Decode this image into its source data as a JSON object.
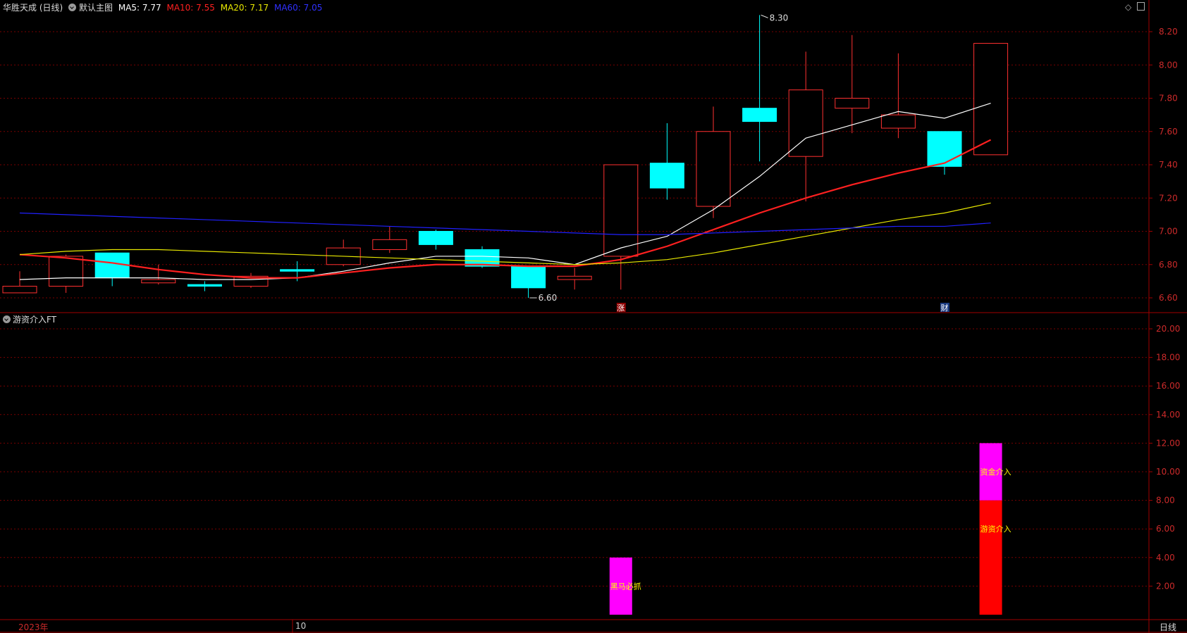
{
  "header": {
    "stock": "华胜天成 (日线)",
    "main_chart": "默认主图",
    "ma5_label": "MA5: 7.77",
    "ma10_label": "MA10: 7.55",
    "ma20_label": "MA20: 7.17",
    "ma60_label": "MA60: 7.05"
  },
  "indicator": {
    "name": "游资介入FT"
  },
  "colors": {
    "ma5": "#ffffff",
    "ma10": "#ff2020",
    "ma20": "#e8e800",
    "ma60": "#2020ff",
    "up": "#ff3030",
    "down": "#00ffff",
    "grid": "#7a0000",
    "frame": "#a00000",
    "axis_text": "#cc2a2a"
  },
  "footer": {
    "year": "2023年",
    "month": "10",
    "period": "日线"
  },
  "chart_data": [
    {
      "type": "candlestick",
      "title": "华胜天成 (日线)",
      "ylim": [
        6.55,
        8.3
      ],
      "yticks": [
        "6.60",
        "6.80",
        "7.00",
        "7.20",
        "7.40",
        "7.60",
        "7.80",
        "8.00",
        "8.20"
      ],
      "candles": [
        {
          "o": 6.63,
          "c": 6.67,
          "h": 6.76,
          "l": 6.63
        },
        {
          "o": 6.67,
          "c": 6.85,
          "h": 6.86,
          "l": 6.63
        },
        {
          "o": 6.87,
          "c": 6.72,
          "h": 6.87,
          "l": 6.67
        },
        {
          "o": 6.69,
          "c": 6.71,
          "h": 6.8,
          "l": 6.68
        },
        {
          "o": 6.68,
          "c": 6.67,
          "h": 6.7,
          "l": 6.64
        },
        {
          "o": 6.67,
          "c": 6.73,
          "h": 6.75,
          "l": 6.66
        },
        {
          "o": 6.77,
          "c": 6.76,
          "h": 6.82,
          "l": 6.7
        },
        {
          "o": 6.8,
          "c": 6.9,
          "h": 6.95,
          "l": 6.79
        },
        {
          "o": 6.89,
          "c": 6.95,
          "h": 7.03,
          "l": 6.87
        },
        {
          "o": 7.0,
          "c": 6.92,
          "h": 7.01,
          "l": 6.89
        },
        {
          "o": 6.89,
          "c": 6.79,
          "h": 6.91,
          "l": 6.78
        },
        {
          "o": 6.79,
          "c": 6.66,
          "h": 6.79,
          "l": 6.6
        },
        {
          "o": 6.71,
          "c": 6.73,
          "h": 6.78,
          "l": 6.65
        },
        {
          "o": 6.85,
          "c": 7.4,
          "h": 7.4,
          "l": 6.65
        },
        {
          "o": 7.41,
          "c": 7.26,
          "h": 7.65,
          "l": 7.19
        },
        {
          "o": 7.15,
          "c": 7.6,
          "h": 7.75,
          "l": 7.08
        },
        {
          "o": 7.74,
          "c": 7.66,
          "h": 8.3,
          "l": 7.42
        },
        {
          "o": 7.45,
          "c": 7.85,
          "h": 8.08,
          "l": 7.18
        },
        {
          "o": 7.74,
          "c": 7.8,
          "h": 8.18,
          "l": 7.59
        },
        {
          "o": 7.62,
          "c": 7.7,
          "h": 8.07,
          "l": 7.56
        },
        {
          "o": 7.6,
          "c": 7.39,
          "h": 7.6,
          "l": 7.34
        },
        {
          "o": 7.46,
          "c": 8.13,
          "h": 8.13,
          "l": 7.46
        }
      ],
      "series": [
        {
          "name": "MA5",
          "values": [
            6.71,
            6.72,
            6.72,
            6.72,
            6.71,
            6.71,
            6.72,
            6.76,
            6.81,
            6.85,
            6.85,
            6.84,
            6.8,
            6.9,
            6.97,
            7.13,
            7.33,
            7.56,
            7.64,
            7.72,
            7.68,
            7.77
          ]
        },
        {
          "name": "MA10",
          "values": [
            6.86,
            6.84,
            6.81,
            6.77,
            6.74,
            6.72,
            6.72,
            6.75,
            6.78,
            6.8,
            6.8,
            6.79,
            6.79,
            6.83,
            6.91,
            7.01,
            7.11,
            7.2,
            7.28,
            7.35,
            7.41,
            7.55
          ]
        },
        {
          "name": "MA20",
          "values": [
            6.86,
            6.88,
            6.89,
            6.89,
            6.88,
            6.87,
            6.86,
            6.85,
            6.84,
            6.83,
            6.82,
            6.81,
            6.8,
            6.81,
            6.83,
            6.87,
            6.92,
            6.97,
            7.02,
            7.07,
            7.11,
            7.17
          ]
        },
        {
          "name": "MA60",
          "values": [
            7.11,
            7.1,
            7.09,
            7.08,
            7.07,
            7.06,
            7.05,
            7.04,
            7.03,
            7.02,
            7.01,
            7.0,
            6.99,
            6.98,
            6.98,
            6.99,
            7.0,
            7.01,
            7.02,
            7.03,
            7.03,
            7.05
          ]
        }
      ],
      "annotations": [
        {
          "index": 16,
          "label": "8.30"
        },
        {
          "index": 11,
          "label": "6.60"
        }
      ],
      "markers": [
        {
          "index": 13,
          "label": "涨",
          "bg": "#8b0000",
          "color": "#ffffff"
        },
        {
          "index": 20,
          "label": "财",
          "bg": "#1a3a80",
          "color": "#ffffff"
        }
      ]
    },
    {
      "type": "bar",
      "title": "游资介入FT",
      "ylim": [
        0,
        21
      ],
      "yticks": [
        "2.00",
        "4.00",
        "6.00",
        "8.00",
        "10.00",
        "12.00",
        "14.00",
        "16.00",
        "18.00",
        "20.00"
      ],
      "bars": [
        {
          "index": 13,
          "from": 0,
          "to": 4,
          "color": "#ff00ff",
          "label": "黑马必抓",
          "label_value": 2,
          "label_color": "#ffff00"
        },
        {
          "index": 21,
          "from": 0,
          "to": 8,
          "color": "#ff0000",
          "label": "游资介入",
          "label_value": 6,
          "label_color": "#ffff00"
        },
        {
          "index": 21,
          "from": 8,
          "to": 12,
          "color": "#ff00ff",
          "label": "资金介入",
          "label_value": 10,
          "label_color": "#ffff00"
        }
      ]
    }
  ]
}
